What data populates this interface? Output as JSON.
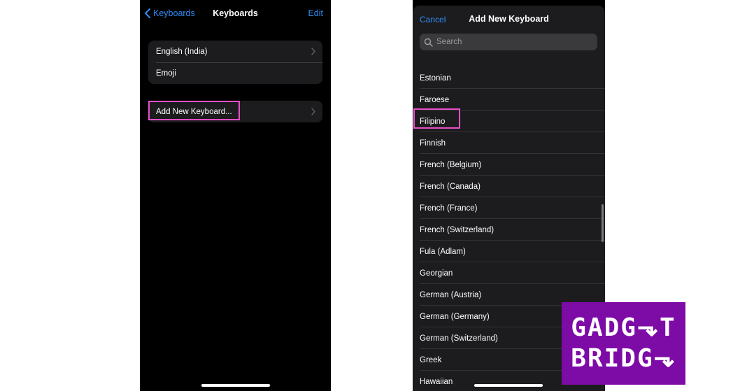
{
  "left_screen": {
    "nav": {
      "back_label": "Keyboards",
      "title": "Keyboards",
      "edit_label": "Edit"
    },
    "keyboards": [
      {
        "label": "English (India)",
        "has_chevron": true
      },
      {
        "label": "Emoji",
        "has_chevron": false
      }
    ],
    "add_new_label": "Add New Keyboard..."
  },
  "right_screen": {
    "cancel_label": "Cancel",
    "title": "Add New Keyboard",
    "search_placeholder": "Search",
    "languages": [
      "Estonian",
      "Faroese",
      "Filipino",
      "Finnish",
      "French (Belgium)",
      "French (Canada)",
      "French (France)",
      "French (Switzerland)",
      "Fula (Adlam)",
      "Georgian",
      "German (Austria)",
      "German (Germany)",
      "German (Switzerland)",
      "Greek",
      "Hawaiian"
    ]
  },
  "logo": {
    "line1": "GADG⬎T",
    "line2": "BRIDG⬎"
  },
  "colors": {
    "accent_blue": "#2f8cf5",
    "highlight_pink": "#e64fc7",
    "logo_purple": "#7d0ba6",
    "cell_bg": "#1c1c1e"
  }
}
